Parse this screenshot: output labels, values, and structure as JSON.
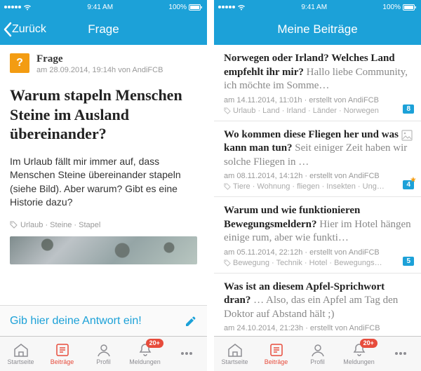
{
  "statusbar": {
    "carrier_dots": 5,
    "time": "9:41 AM",
    "battery": "100%"
  },
  "left": {
    "nav": {
      "back": "Zurück",
      "title": "Frage"
    },
    "post": {
      "type_label": "Frage",
      "meta": "am 28.09.2014, 19:14h von AndiFCB",
      "title": "Warum stapeln Menschen Steine im Ausland übereinander?",
      "body": "Im Urlaub fällt mir immer auf, dass Menschen Steine übereinander stapeln (siehe Bild). Aber warum? Gibt es eine Historie dazu?",
      "tags": "Urlaub · Steine · Stapel"
    },
    "answer_placeholder": "Gib hier deine Antwort ein!"
  },
  "right": {
    "nav": {
      "title": "Meine Beiträge"
    },
    "items": [
      {
        "title": "Norwegen oder Irland? Welches Land empfehlt ihr mir?",
        "snippet": " Hallo liebe Community, ich möchte im Somme…",
        "meta": "am 14.11.2014, 11:01h · erstellt von AndiFCB",
        "tags": "Urlaub · Land · Irland · Länder · Norwegen",
        "count": "8",
        "starred": false
      },
      {
        "title": "Wo kommen diese Fliegen her und was kann man tun?",
        "snippet": " Seit einiger Zeit haben wir solche Fliegen in …",
        "meta": "am 08.11.2014, 14:12h · erstellt von AndiFCB",
        "tags": "Tiere · Wohnung · fliegen · Insekten · Ung…",
        "count": "4",
        "starred": true
      },
      {
        "title": "Warum und wie funktionieren Bewegungsmeldern?",
        "snippet": " Hier im Hotel hängen einige rum, aber wie funkti…",
        "meta": "am 05.11.2014, 22:12h · erstellt von AndiFCB",
        "tags": "Bewegung · Technik · Hotel · Bewegungs…",
        "count": "5",
        "starred": false
      },
      {
        "title": "Was ist an diesem Apfel-Sprichwort dran?",
        "snippet": " … Also, das ein Apfel am Tag den Doktor auf Abstand hält ;)",
        "meta": "am 24.10.2014, 21:23h · erstellt von AndiFCB",
        "tags": "",
        "count": "",
        "starred": false
      }
    ]
  },
  "tabs": {
    "items": [
      {
        "label": "Startseite"
      },
      {
        "label": "Beiträge"
      },
      {
        "label": "Profil"
      },
      {
        "label": "Meldungen"
      },
      {
        "label": ""
      }
    ],
    "badge": "20+",
    "active_index": 1
  }
}
